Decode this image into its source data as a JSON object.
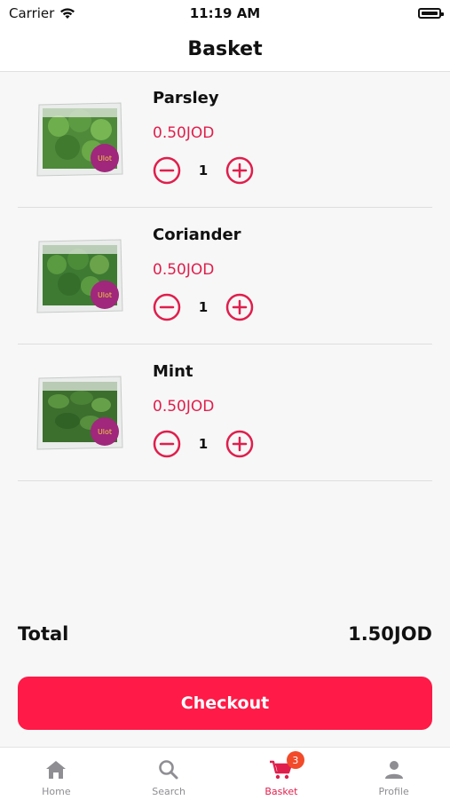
{
  "status_bar": {
    "carrier": "Carrier",
    "time": "11:19 AM"
  },
  "header": {
    "title": "Basket"
  },
  "items": [
    {
      "name": "Parsley",
      "price": "0.50JOD",
      "quantity": "1"
    },
    {
      "name": "Coriander",
      "price": "0.50JOD",
      "quantity": "1"
    },
    {
      "name": "Mint",
      "price": "0.50JOD",
      "quantity": "1"
    }
  ],
  "summary": {
    "total_label": "Total",
    "total_value": "1.50JOD"
  },
  "checkout_label": "Checkout",
  "tabs": [
    {
      "label": "Home",
      "icon": "home-icon"
    },
    {
      "label": "Search",
      "icon": "search-icon"
    },
    {
      "label": "Basket",
      "icon": "cart-icon",
      "badge": "3",
      "active": true
    },
    {
      "label": "Profile",
      "icon": "profile-icon"
    }
  ],
  "colors": {
    "accent": "#ff1a47",
    "price": "#e01e4c",
    "badge": "#f24b2a"
  }
}
